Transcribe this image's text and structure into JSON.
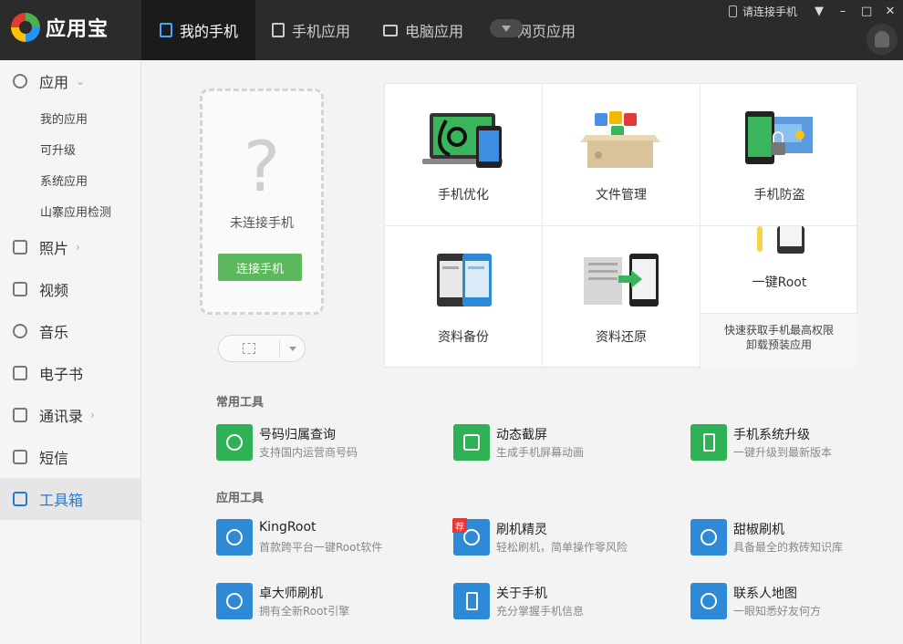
{
  "app": {
    "name": "应用宝"
  },
  "nav": {
    "tabs": [
      {
        "label": "我的手机",
        "icon": "phone-icon"
      },
      {
        "label": "手机应用",
        "icon": "phone-app-icon"
      },
      {
        "label": "电脑应用",
        "icon": "monitor-icon"
      },
      {
        "label": "网页应用",
        "icon": "web-page-icon"
      }
    ],
    "active_index": 0
  },
  "window": {
    "connect_hint": "请连接手机"
  },
  "sidebar": {
    "items": [
      {
        "label": "应用",
        "icon": "app-icon",
        "expanded": true
      },
      {
        "label": "照片",
        "icon": "photo-icon"
      },
      {
        "label": "视频",
        "icon": "video-icon"
      },
      {
        "label": "音乐",
        "icon": "music-icon"
      },
      {
        "label": "电子书",
        "icon": "book-icon"
      },
      {
        "label": "通讯录",
        "icon": "contacts-icon"
      },
      {
        "label": "短信",
        "icon": "sms-icon"
      },
      {
        "label": "工具箱",
        "icon": "toolbox-icon",
        "active": true
      }
    ],
    "sub_items": [
      "我的应用",
      "可升级",
      "系统应用",
      "山寨应用检测"
    ]
  },
  "phone": {
    "placeholder_glyph": "?",
    "status": "未连接手机",
    "connect_button": "连接手机"
  },
  "features": [
    {
      "label": "手机优化",
      "icon": "phone-optimize-icon"
    },
    {
      "label": "文件管理",
      "icon": "file-manager-icon"
    },
    {
      "label": "手机防盗",
      "icon": "anti-theft-icon"
    },
    {
      "label": "资料备份",
      "icon": "backup-icon"
    },
    {
      "label": "资料还原",
      "icon": "restore-icon"
    },
    {
      "label": "一键Root",
      "icon": "root-icon"
    }
  ],
  "root_tip": {
    "line1": "快速获取手机最高权限",
    "line2": "卸载预装应用"
  },
  "common_tools": {
    "title": "常用工具",
    "items": [
      {
        "name": "号码归属查询",
        "desc": "支持国内运营商号码",
        "icon": "phone-lookup-icon"
      },
      {
        "name": "动态截屏",
        "desc": "生成手机屏幕动画",
        "icon": "screen-capture-icon"
      },
      {
        "name": "手机系统升级",
        "desc": "一键升级到最新版本",
        "icon": "system-upgrade-icon"
      }
    ]
  },
  "app_tools": {
    "title": "应用工具",
    "items": [
      {
        "name": "KingRoot",
        "desc": "首款跨平台一键Root软件",
        "icon": "kingroot-icon"
      },
      {
        "name": "刷机精灵",
        "desc": "轻松刷机，简单操作零风险",
        "icon": "flash-wizard-icon",
        "badge": "荐"
      },
      {
        "name": "甜椒刷机",
        "desc": "具备最全的救砖知识库",
        "icon": "tianjiao-icon"
      },
      {
        "name": "卓大师刷机",
        "desc": "拥有全新Root引擎",
        "icon": "zhuo-master-icon"
      },
      {
        "name": "关于手机",
        "desc": "充分掌握手机信息",
        "icon": "about-phone-icon"
      },
      {
        "name": "联系人地图",
        "desc": "一眼知悉好友何方",
        "icon": "contact-map-icon"
      }
    ]
  }
}
